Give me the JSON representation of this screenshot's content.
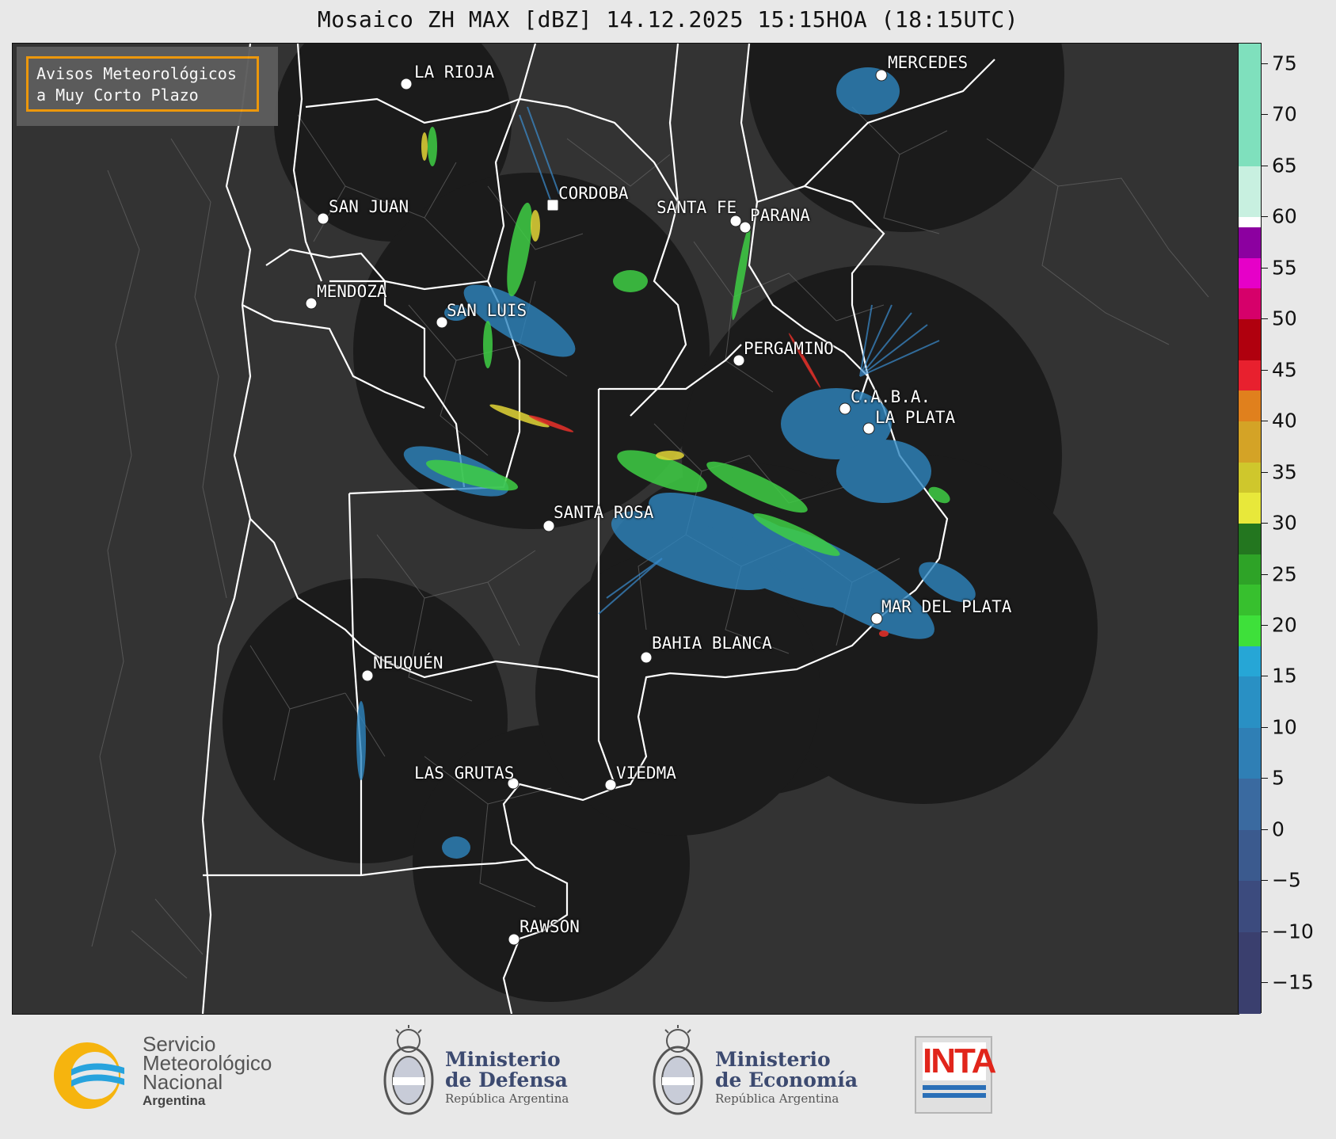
{
  "title": "Mosaico ZH MAX [dBZ] 14.12.2025 15:15HOA (18:15UTC)",
  "avisos": {
    "line1": "Avisos Meteorológicos",
    "line2": "a Muy Corto Plazo"
  },
  "cities": [
    {
      "name": "LA RIOJA"
    },
    {
      "name": "CORDOBA"
    },
    {
      "name": "SAN JUAN"
    },
    {
      "name": "MENDOZA"
    },
    {
      "name": "SAN LUIS"
    },
    {
      "name": "SANTA FE"
    },
    {
      "name": "PARANA"
    },
    {
      "name": "PERGAMINO"
    },
    {
      "name": "C.A.B.A."
    },
    {
      "name": "LA PLATA"
    },
    {
      "name": "MERCEDES"
    },
    {
      "name": "SANTA ROSA"
    },
    {
      "name": "MAR DEL PLATA"
    },
    {
      "name": "BAHIA BLANCA"
    },
    {
      "name": "NEUQUÉN"
    },
    {
      "name": "LAS GRUTAS"
    },
    {
      "name": "VIEDMA"
    },
    {
      "name": "RAWSON"
    }
  ],
  "colorbar": {
    "unit": "dBZ",
    "min": -18,
    "max": 77,
    "ticks": [
      "75",
      "70",
      "65",
      "60",
      "55",
      "50",
      "45",
      "40",
      "35",
      "30",
      "25",
      "20",
      "15",
      "10",
      "5",
      "0",
      "−5",
      "−10",
      "−15"
    ],
    "tick_values": [
      75,
      70,
      65,
      60,
      55,
      50,
      45,
      40,
      35,
      30,
      25,
      20,
      15,
      10,
      5,
      0,
      -5,
      -10,
      -15
    ],
    "bands": [
      {
        "from": -18,
        "to": -10,
        "color": "#3a3f6e"
      },
      {
        "from": -10,
        "to": -5,
        "color": "#3c4b7e"
      },
      {
        "from": -5,
        "to": 0,
        "color": "#3b5a8e"
      },
      {
        "from": 0,
        "to": 5,
        "color": "#3a6aa0"
      },
      {
        "from": 5,
        "to": 10,
        "color": "#2f7fb5"
      },
      {
        "from": 10,
        "to": 15,
        "color": "#2990c4"
      },
      {
        "from": 15,
        "to": 18,
        "color": "#26a6d6"
      },
      {
        "from": 18,
        "to": 21,
        "color": "#3ee03a"
      },
      {
        "from": 21,
        "to": 24,
        "color": "#37c02e"
      },
      {
        "from": 24,
        "to": 27,
        "color": "#2ea327"
      },
      {
        "from": 27,
        "to": 30,
        "color": "#23761f"
      },
      {
        "from": 30,
        "to": 33,
        "color": "#e8e83a"
      },
      {
        "from": 33,
        "to": 36,
        "color": "#cfc72c"
      },
      {
        "from": 36,
        "to": 40,
        "color": "#d4a326"
      },
      {
        "from": 40,
        "to": 43,
        "color": "#e0801d"
      },
      {
        "from": 43,
        "to": 46,
        "color": "#e8202e"
      },
      {
        "from": 46,
        "to": 50,
        "color": "#b0000e"
      },
      {
        "from": 50,
        "to": 53,
        "color": "#d6006a"
      },
      {
        "from": 53,
        "to": 56,
        "color": "#e600c8"
      },
      {
        "from": 56,
        "to": 59,
        "color": "#8c00a0"
      },
      {
        "from": 59,
        "to": 60,
        "color": "#ffffff"
      },
      {
        "from": 60,
        "to": 65,
        "color": "#c8f0e0"
      },
      {
        "from": 65,
        "to": 77,
        "color": "#7fe0bd"
      }
    ]
  },
  "footer": {
    "smn": {
      "line1": "Servicio",
      "line2": "Meteorológico",
      "line3": "Nacional",
      "line4": "Argentina"
    },
    "defensa": {
      "line1": "Ministerio",
      "line2": "de Defensa",
      "line3": "República Argentina"
    },
    "economia": {
      "line1": "Ministerio",
      "line2": "de Economía",
      "line3": "República Argentina"
    },
    "inta": "INTA"
  },
  "colors": {
    "map_background": "#333333",
    "radar_coverage": "#1b1b1b",
    "borders": "#ffffff",
    "accent": "#f29b0a"
  }
}
